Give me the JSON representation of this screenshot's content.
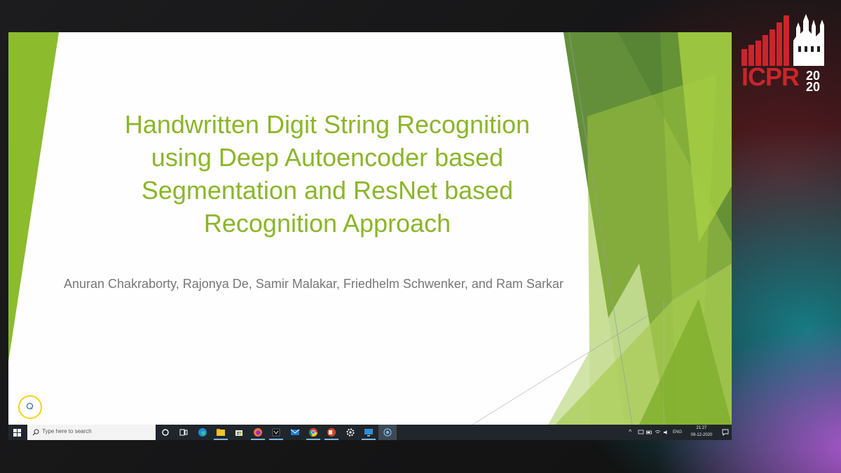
{
  "logo": {
    "text": "ICPR",
    "year_top": "20",
    "year_bottom": "20"
  },
  "slide": {
    "title_lines": [
      "Handwritten Digit String Recognition",
      "using Deep Autoencoder based",
      "Segmentation and ResNet based",
      "Recognition Approach"
    ],
    "authors": "Anuran Chakraborty, Rajonya De, Samir Malakar, Friedhelm Schwenker, and Ram Sarkar"
  },
  "taskbar": {
    "search_placeholder": "Type here to search",
    "apps": [
      "start-icon",
      "search-icon",
      "task-view-icon",
      "edge-icon",
      "file-explorer-icon",
      "store-icon",
      "firefox-icon",
      "app-icon",
      "mail-icon",
      "chrome-icon",
      "powerpoint-icon",
      "settings-icon",
      "remote-desktop-icon",
      "recording-icon"
    ],
    "tray": {
      "language": "ENG",
      "time": "21:27",
      "date": "09-12-2020"
    }
  },
  "colors": {
    "accent_green": "#8cb52a",
    "logo_red": "#c8262b",
    "taskbar": "#20262b"
  }
}
